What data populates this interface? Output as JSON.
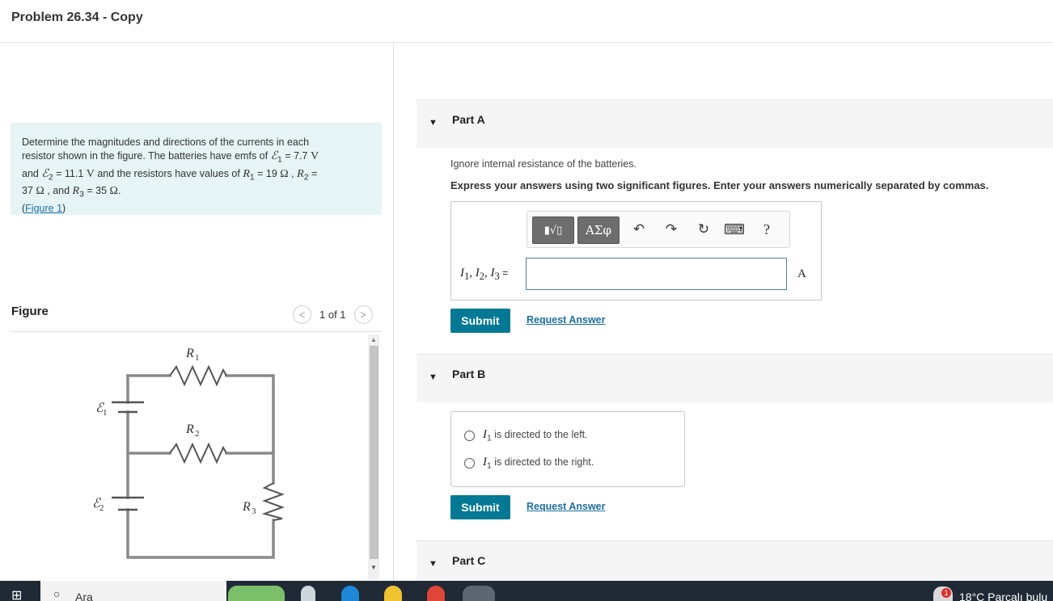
{
  "header": {
    "title": "Problem 26.34 - Copy"
  },
  "problem": {
    "line1": "Determine the magnitudes and directions of the currents in each",
    "line2_prefix": "resistor shown in the figure. The batteries have emfs of ",
    "emf1_sym": "ℰ",
    "emf1_sub": "1",
    "emf1_val": " = 7.7 ",
    "emf1_unit": "V",
    "and": "and ",
    "emf2_sym": "ℰ",
    "emf2_sub": "2",
    "emf2_val": " = 11.1 ",
    "emf2_unit": "V",
    "resistors_text": " and the resistors have values of ",
    "r1_sym": "R",
    "r1_sub": "1",
    "r1_val": " = 19 ",
    "omega": "Ω",
    "comma": " , ",
    "r2_sym": "R",
    "r2_sub": "2",
    "r2_eq": " =",
    "r2_val": "37 ",
    "and_r3": " , and ",
    "r3_sym": "R",
    "r3_sub": "3",
    "r3_val": " = 35 ",
    "period": ".",
    "link_open": "(",
    "figure_link": "Figure 1",
    "link_close": ")"
  },
  "figure": {
    "heading": "Figure",
    "prev": "<",
    "next": ">",
    "counter": "1 of 1",
    "labels": {
      "r1": "R",
      "r1_sub": "1",
      "r2": "R",
      "r2_sub": "2",
      "r3": "R",
      "r3_sub": "3",
      "e1": "ℰ",
      "e1_sub": "1",
      "e2": "ℰ",
      "e2_sub": "2"
    }
  },
  "partA": {
    "title": "Part A",
    "ignore": "Ignore internal resistance of the batteries.",
    "express": "Express your answers using two significant figures. Enter your answers numerically separated by commas.",
    "toolbar": {
      "template_icon": "▮√▯",
      "greek": "ΑΣφ",
      "undo": "↶",
      "redo": "↷",
      "reset": "↻",
      "keyboard": "⌨",
      "help": "?"
    },
    "var_label": {
      "i": "I",
      "s1": "1",
      "sep1": ", ",
      "s2": "2",
      "sep2": ", ",
      "s3": "3",
      "eq": " ="
    },
    "input_value": "",
    "unit": "A",
    "submit": "Submit",
    "request": "Request Answer"
  },
  "partB": {
    "title": "Part B",
    "choices": [
      {
        "sym": "I",
        "sub": "1",
        "text": " is directed to the left."
      },
      {
        "sym": "I",
        "sub": "1",
        "text": " is directed to the right."
      }
    ],
    "submit": "Submit",
    "request": "Request Answer"
  },
  "partC": {
    "title": "Part C"
  },
  "taskbar": {
    "search_text": "Ara",
    "weather": "18°C  Parçalı bulu",
    "badge": "1"
  },
  "colors": {
    "accent": "#037995",
    "link": "#1b6ea0",
    "problem_bg": "#e6f4f5"
  }
}
